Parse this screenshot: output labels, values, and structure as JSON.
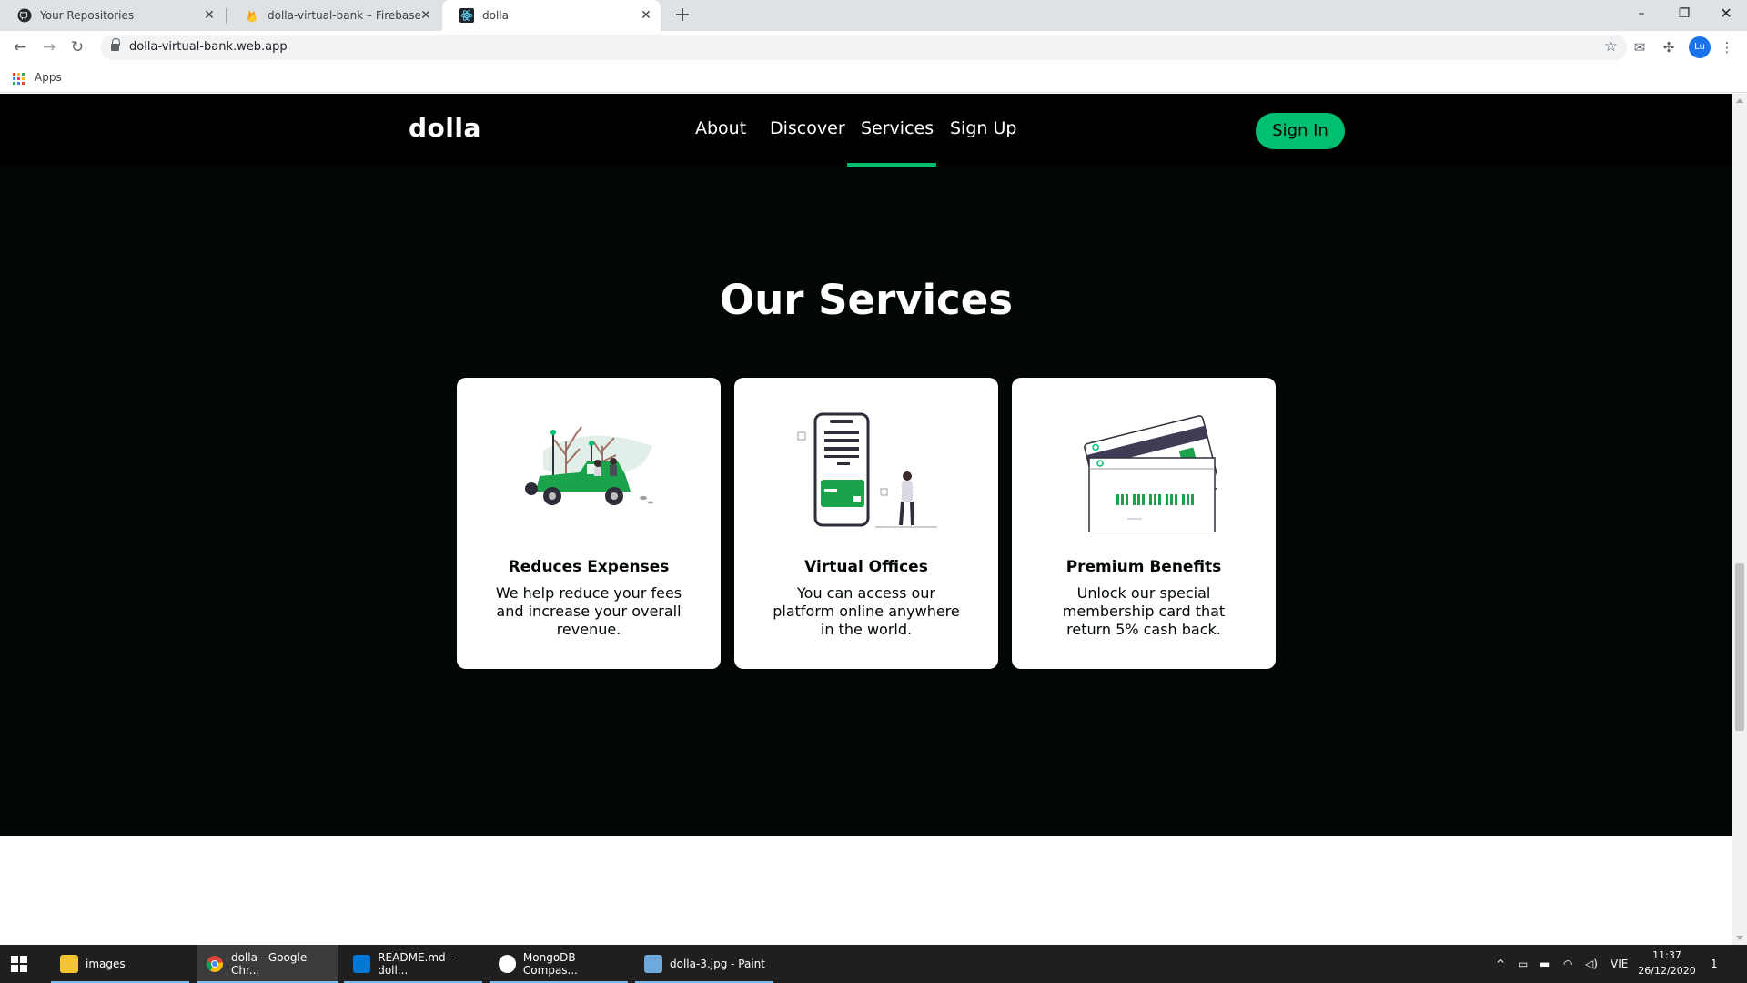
{
  "browser": {
    "tabs": [
      {
        "title": "Your Repositories",
        "icon": "github-icon"
      },
      {
        "title": "dolla-virtual-bank – Firebase con",
        "icon": "firebase-icon"
      },
      {
        "title": "dolla",
        "icon": "react-icon",
        "active": true
      }
    ],
    "new_tab": "+",
    "url": "dolla-virtual-bank.web.app",
    "bookmarks": {
      "apps_label": "Apps"
    },
    "window_controls": [
      "minimize-icon",
      "restore-icon",
      "close-icon"
    ],
    "profile_initials": "Lu"
  },
  "site": {
    "logo": "dolla",
    "menu": [
      "About",
      "Discover",
      "Services",
      "Sign Up"
    ],
    "active_menu": "Services",
    "signin_label": "Sign In",
    "accent_color": "#01bf71",
    "background_color": "#010606"
  },
  "services": {
    "title": "Our Services",
    "cards": [
      {
        "title": "Reduces Expenses",
        "description": "We help reduce your fees and increase your overall revenue.",
        "illustration": "car-illustration"
      },
      {
        "title": "Virtual Offices",
        "description": "You can access our platform online anywhere in the world.",
        "illustration": "phone-illustration"
      },
      {
        "title": "Premium Benefits",
        "description": "Unlock our special membership card that return 5% cash back.",
        "illustration": "card-illustration"
      }
    ]
  },
  "taskbar": {
    "items": [
      {
        "label": "images",
        "icon": "folder-icon"
      },
      {
        "label": "dolla - Google Chr...",
        "icon": "chrome-icon",
        "active": true
      },
      {
        "label": "README.md - doll...",
        "icon": "vscode-icon"
      },
      {
        "label": "MongoDB Compas...",
        "icon": "mongodb-icon"
      },
      {
        "label": "dolla-3.jpg - Paint",
        "icon": "paint-icon"
      }
    ],
    "language": "VIE",
    "time": "11:37",
    "date": "26/12/2020",
    "notification_count": "1"
  }
}
